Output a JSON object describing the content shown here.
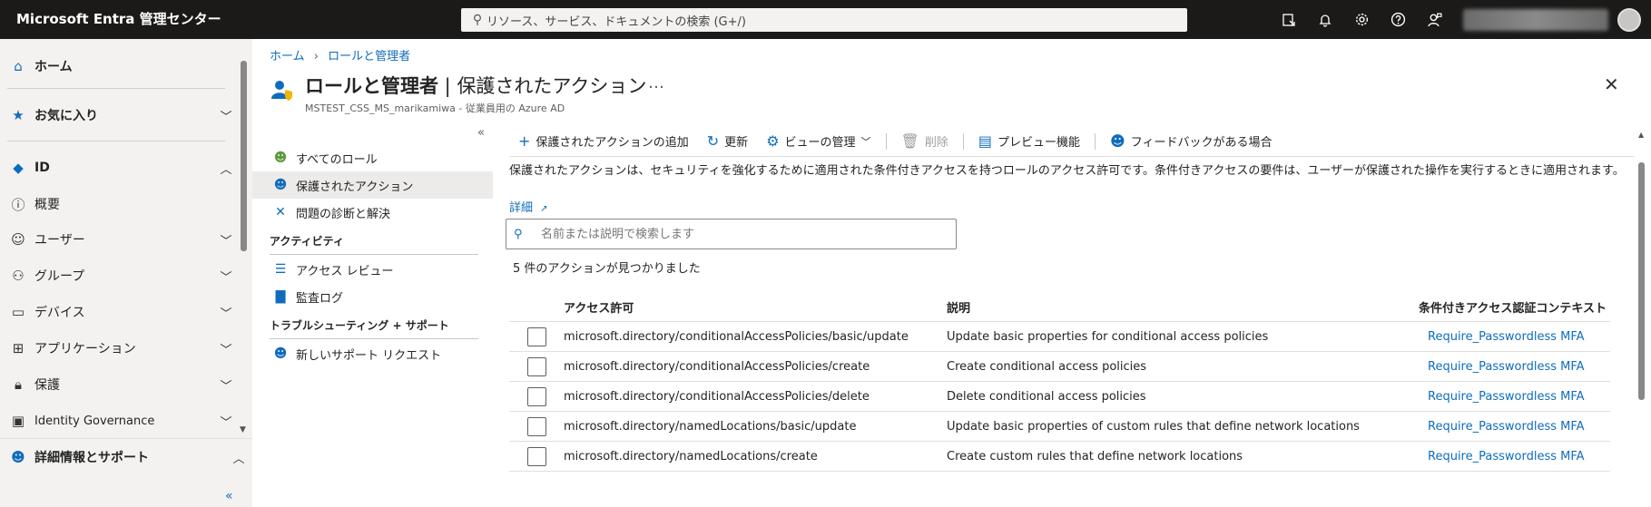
{
  "topbar": {
    "brand": "Microsoft Entra 管理センター",
    "search_placeholder": "リソース、サービス、ドキュメントの検索 (G+/)",
    "icons": [
      "feedback-panel-icon",
      "bell-icon",
      "gear-icon",
      "help-icon",
      "person-feedback-icon"
    ]
  },
  "leftnav": {
    "items": [
      {
        "label": "ホーム",
        "icon": "home-icon",
        "bold": true
      },
      {
        "label": "お気に入り",
        "icon": "star-icon",
        "bold": true
      },
      {
        "label": "ID",
        "icon": "identity-diamond-icon",
        "bold": true
      },
      {
        "label": "概要",
        "icon": "info-icon"
      },
      {
        "label": "ユーザー",
        "icon": "person-icon"
      },
      {
        "label": "グループ",
        "icon": "people-icon"
      },
      {
        "label": "デバイス",
        "icon": "device-icon"
      },
      {
        "label": "アプリケーション",
        "icon": "apps-icon"
      },
      {
        "label": "保護",
        "icon": "lock-icon"
      },
      {
        "label": "Identity Governance",
        "icon": "governance-icon"
      }
    ],
    "footer": {
      "label": "詳細情報とサポート",
      "icon": "support-person-icon"
    }
  },
  "breadcrumb": {
    "home": "ホーム",
    "roles": "ロールと管理者"
  },
  "page": {
    "title_main": "ロールと管理者",
    "title_sep": " | ",
    "title_sub": "保護されたアクション",
    "more": "…",
    "subtitle": "MSTEST_CSS_MS_marikamiwa - 従業員用の Azure AD"
  },
  "resmenu": {
    "items": [
      {
        "label": "すべてのロール",
        "icon": "roles-icon"
      },
      {
        "label": "保護されたアクション",
        "icon": "protected-actions-icon",
        "selected": true
      },
      {
        "label": "問題の診断と解決",
        "icon": "wrench-icon"
      }
    ],
    "section_activity": "アクティビティ",
    "activity_items": [
      {
        "label": "アクセス レビュー",
        "icon": "access-review-icon"
      },
      {
        "label": "監査ログ",
        "icon": "audit-log-icon"
      }
    ],
    "section_support": "トラブルシューティング + サポート",
    "support_items": [
      {
        "label": "新しいサポート リクエスト",
        "icon": "support-request-icon"
      }
    ]
  },
  "toolbar": {
    "add": "保護されたアクションの追加",
    "refresh": "更新",
    "manage_view": "ビューの管理",
    "delete": "削除",
    "preview": "プレビュー機能",
    "feedback": "フィードバックがある場合"
  },
  "content": {
    "description": "保護されたアクションは、セキュリティを強化するために適用された条件付きアクセスを持つロールのアクセス許可です。条件付きアクセスの要件は、ユーザーが保護された操作を実行するときに適用されます。",
    "detail_link": "詳細",
    "search_placeholder": "名前または説明で検索します",
    "count": "5 件のアクションが見つかりました"
  },
  "table": {
    "headers": {
      "permission": "アクセス許可",
      "description": "説明",
      "context": "条件付きアクセス認証コンテキスト"
    },
    "rows": [
      {
        "permission": "microsoft.directory/conditionalAccessPolicies/basic/update",
        "description": "Update basic properties for conditional access policies",
        "context": "Require_Passwordless MFA"
      },
      {
        "permission": "microsoft.directory/conditionalAccessPolicies/create",
        "description": "Create conditional access policies",
        "context": "Require_Passwordless MFA"
      },
      {
        "permission": "microsoft.directory/conditionalAccessPolicies/delete",
        "description": "Delete conditional access policies",
        "context": "Require_Passwordless MFA"
      },
      {
        "permission": "microsoft.directory/namedLocations/basic/update",
        "description": "Update basic properties of custom rules that define network locations",
        "context": "Require_Passwordless MFA"
      },
      {
        "permission": "microsoft.directory/namedLocations/create",
        "description": "Create custom rules that define network locations",
        "context": "Require_Passwordless MFA"
      }
    ]
  },
  "colors": {
    "accent": "#0f6cbd",
    "topbar": "#1b1a19",
    "nav_bg": "#f3f2f1"
  }
}
